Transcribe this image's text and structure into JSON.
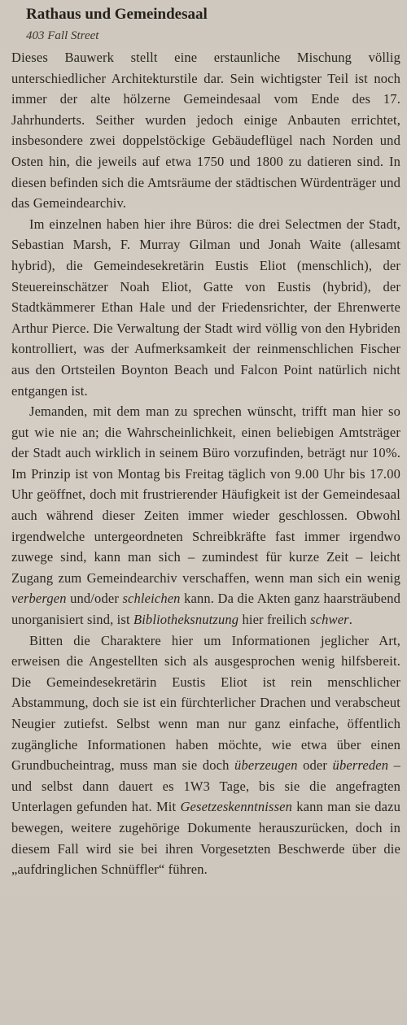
{
  "section": {
    "title": "Rathaus und Gemeindesaal",
    "address": "403 Fall Street"
  },
  "paragraphs": [
    {
      "parts": [
        {
          "text": "Dieses Bauwerk stellt eine erstaunliche Mischung völlig unterschiedlicher Architekturstile dar. Sein wichtigster Teil ist noch immer der alte hölzerne Gemeindesaal vom Ende des 17. Jahrhunderts. Seither wurden jedoch einige Anbauten errichtet, insbesondere zwei doppelstöckige Gebäudeflügel nach Norden und Osten hin, die jeweils auf etwa 1750 und 1800 zu datieren sind. In diesen befinden sich die Amtsräume der städtischen Würdenträger und das Gemeindearchiv.",
          "italic": false
        }
      ]
    },
    {
      "parts": [
        {
          "text": "Im einzelnen haben hier ihre Büros: die drei Selectmen der Stadt, Sebastian Marsh, F. Murray Gilman und Jonah Waite (allesamt hybrid), die Gemeindesekretärin Eustis Eliot (menschlich), der Steuereinschätzer Noah Eliot, Gatte von Eustis (hybrid), der Stadtkämmerer Ethan Hale und der Friedensrichter, der Ehrenwerte Arthur Pierce. Die Verwaltung der Stadt wird völlig von den Hybriden kontrolliert, was der Aufmerksamkeit der reinmenschlichen Fischer aus den Ortsteilen Boynton Beach und Falcon Point natürlich nicht entgangen ist.",
          "italic": false
        }
      ]
    },
    {
      "parts": [
        {
          "text": "Jemanden, mit dem man zu sprechen wünscht, trifft man hier so gut wie nie an; die Wahrscheinlichkeit, einen beliebigen Amtsträger der Stadt auch wirklich in seinem Büro vorzufinden, beträgt nur 10%. Im Prinzip ist von Montag bis Freitag täglich von 9.00 Uhr bis 17.00 Uhr geöffnet, doch mit frustrierender Häufigkeit ist der Gemeindesaal auch während dieser Zeiten immer wieder geschlossen. Obwohl irgendwelche untergeordneten Schreibkräfte fast immer irgendwo zuwege sind, kann man sich – zumindest für kurze Zeit – leicht Zugang zum Gemeindearchiv verschaffen, wenn man sich ein wenig ",
          "italic": false
        },
        {
          "text": "verbergen",
          "italic": true
        },
        {
          "text": " und/oder ",
          "italic": false
        },
        {
          "text": "schleichen",
          "italic": true
        },
        {
          "text": " kann. Da die Akten ganz haarsträubend unorganisiert sind, ist ",
          "italic": false
        },
        {
          "text": "Bibliotheksnutzung",
          "italic": true
        },
        {
          "text": " hier freilich ",
          "italic": false
        },
        {
          "text": "schwer",
          "italic": true
        },
        {
          "text": ".",
          "italic": false
        }
      ]
    },
    {
      "parts": [
        {
          "text": "Bitten die Charaktere hier um Informationen jeglicher Art, erweisen die Angestellten sich als ausgesprochen wenig hilfsbereit. Die Gemeindesekretärin Eustis Eliot ist rein menschlicher Abstammung, doch sie ist ein fürchterlicher Drachen und verabscheut Neugier zutiefst. Selbst wenn man nur ganz einfache, öffentlich zugängliche Informationen haben möchte, wie etwa über einen Grundbucheintrag, muss man sie doch ",
          "italic": false
        },
        {
          "text": "überzeugen",
          "italic": true
        },
        {
          "text": " oder ",
          "italic": false
        },
        {
          "text": "überreden",
          "italic": true
        },
        {
          "text": " – und selbst dann dauert es 1W3 Tage, bis sie die angefragten Unterlagen gefunden hat. Mit ",
          "italic": false
        },
        {
          "text": "Gesetzeskenntnissen",
          "italic": true
        },
        {
          "text": " kann man sie dazu bewegen, weitere zugehörige Dokumente herauszurücken, doch in diesem Fall wird sie bei ihren Vorgesetzten Beschwerde über die „aufdringlichen Schnüffler“ führen.",
          "italic": false
        }
      ]
    }
  ]
}
